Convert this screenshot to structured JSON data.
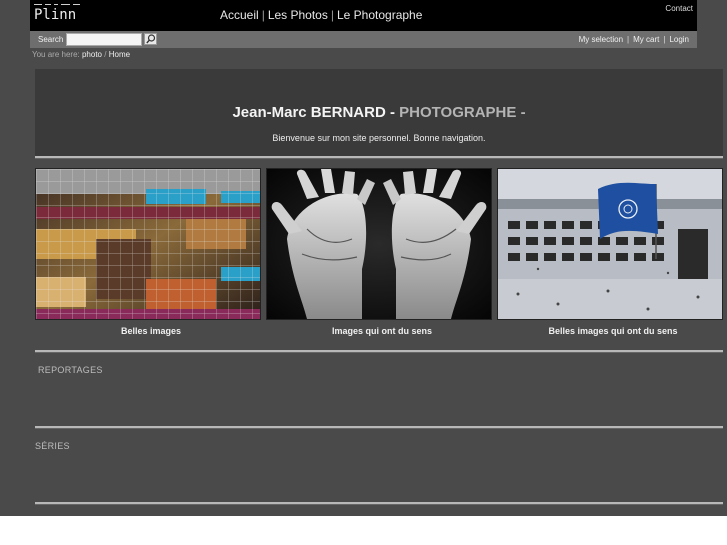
{
  "header": {
    "logo": "Plinn",
    "nav": [
      "Accueil",
      "Les Photos",
      "Le Photographe"
    ],
    "nav_separator": "|",
    "contact": "Contact"
  },
  "searchbar": {
    "label": "Search",
    "input_value": "",
    "user_links": [
      "My selection",
      "My cart",
      "Login"
    ],
    "link_separator": "|"
  },
  "breadcrumb": {
    "prefix": "You are here:",
    "items": [
      "photo",
      "Home"
    ],
    "separator": "/"
  },
  "intro": {
    "name": "Jean-Marc BERNARD",
    "dash": "-",
    "role": "PHOTOGRAPHE -",
    "welcome": "Bienvenue sur mon site personnel. Bonne navigation."
  },
  "gallery": [
    {
      "caption": "Belles images"
    },
    {
      "caption": "Images qui ont du sens"
    },
    {
      "caption": "Belles images qui ont du sens"
    }
  ],
  "sections": {
    "reportages": "REPORTAGES",
    "series": "SÉRIES"
  },
  "colors": {
    "page_bg": "#4a4a4a",
    "topbar": "#000000",
    "searchbar": "#6e6e6e",
    "panel": "#3a3a3a",
    "title_accent": "#b4b4b4"
  }
}
